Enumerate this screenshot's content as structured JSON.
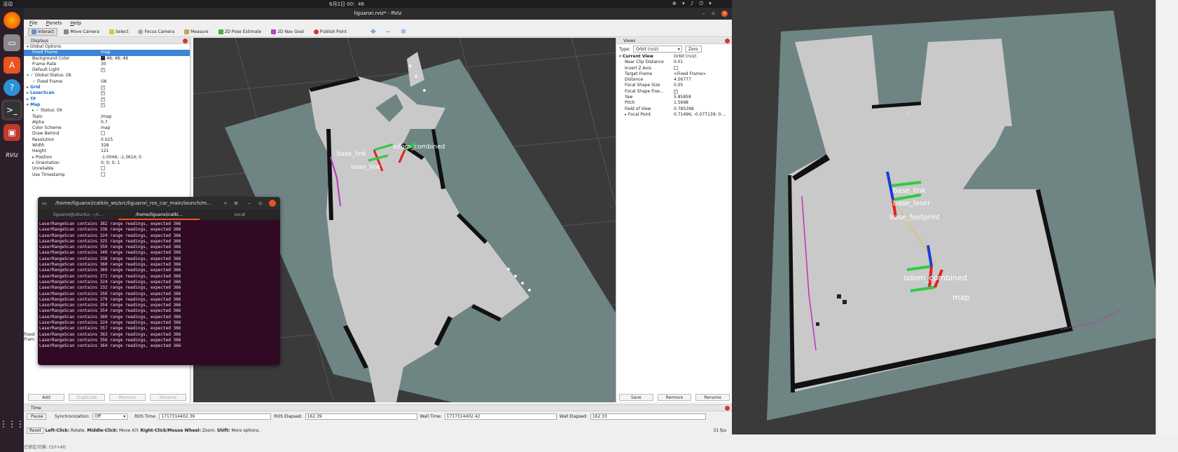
{
  "topbar": {
    "activities": "活动",
    "clock": "6月2日 00：46",
    "tray": "⊕ ▾ ♪ ⏻ ▾"
  },
  "dock": {
    "items": [
      "firefox-icon",
      "files-icon",
      "software-icon",
      "help-icon",
      "terminal-icon",
      "app-icon",
      "rviz-icon",
      "apps-grid-icon"
    ],
    "rviz_label": "RViz"
  },
  "window": {
    "title": "liguanxi.rviz* - RViz"
  },
  "menu": {
    "file": "File",
    "panels": "Panels",
    "help": "Help"
  },
  "toolbar": [
    "Interact",
    "Move Camera",
    "Select",
    "Focus Camera",
    "Measure",
    "2D Pose Estimate",
    "2D Nav Goal",
    "Publish Point"
  ],
  "displays": {
    "title": "Displays",
    "rows": [
      {
        "k": "Global Options",
        "v": "",
        "indent": 1,
        "arrow": "▾",
        "icon": "grid"
      },
      {
        "k": "Fixed Frame",
        "v": "map",
        "indent": 2,
        "hl": true
      },
      {
        "k": "Background Color",
        "v": "48; 48; 48",
        "indent": 2,
        "swatch": true
      },
      {
        "k": "Frame Rate",
        "v": "30",
        "indent": 2
      },
      {
        "k": "Default Light",
        "v": "✓",
        "indent": 2,
        "chk": true
      },
      {
        "k": "Global Status: Ok",
        "v": "",
        "indent": 1,
        "arrow": "▾",
        "check": true
      },
      {
        "k": "Fixed Frame",
        "v": "OK",
        "indent": 2,
        "check": true
      },
      {
        "k": "Grid",
        "v": "✓",
        "indent": 1,
        "arrow": "▸",
        "blue": true,
        "chk": true
      },
      {
        "k": "LaserScan",
        "v": "✓",
        "indent": 1,
        "arrow": "▸",
        "blue": true,
        "chk": true
      },
      {
        "k": "TF",
        "v": "✓",
        "indent": 1,
        "arrow": "▸",
        "blue": true,
        "chk": true
      },
      {
        "k": "Map",
        "v": "✓",
        "indent": 1,
        "arrow": "▾",
        "blue": true,
        "chk": true
      },
      {
        "k": "Status: Ok",
        "v": "",
        "indent": 2,
        "arrow": "▸",
        "check": true
      },
      {
        "k": "Topic",
        "v": "/map",
        "indent": 2
      },
      {
        "k": "Alpha",
        "v": "0.7",
        "indent": 2
      },
      {
        "k": "Color Scheme",
        "v": "map",
        "indent": 2
      },
      {
        "k": "Draw Behind",
        "v": "",
        "indent": 2,
        "chk": true
      },
      {
        "k": "Resolution",
        "v": "0.025",
        "indent": 2
      },
      {
        "k": "Width",
        "v": "328",
        "indent": 2
      },
      {
        "k": "Height",
        "v": "121",
        "indent": 2
      },
      {
        "k": "Position",
        "v": "-1.0046; -1.3614; 0",
        "indent": 2,
        "arrow": "▸"
      },
      {
        "k": "Orientation",
        "v": "0; 0; 0; 1",
        "indent": 2,
        "arrow": "▸"
      },
      {
        "k": "Unreliable",
        "v": "",
        "indent": 2,
        "chk": true
      },
      {
        "k": "Use Timestamp",
        "v": "",
        "indent": 2,
        "chk": true
      }
    ],
    "hidden_label": "Fixed\nFram",
    "buttons": {
      "add": "Add",
      "duplicate": "Duplicate",
      "remove": "Remove",
      "rename": "Rename"
    }
  },
  "views": {
    "title": "Views",
    "type_label": "Type:",
    "type_value": "Orbit (rviz)",
    "zero": "Zero",
    "rows": [
      {
        "k": "Current View",
        "v": "Orbit (rviz)",
        "indent": 1,
        "arrow": "▾",
        "bold": true
      },
      {
        "k": "Near Clip Distance",
        "v": "0.01",
        "indent": 2
      },
      {
        "k": "Invert Z Axis",
        "v": "",
        "indent": 2,
        "chk": true
      },
      {
        "k": "Target Frame",
        "v": "<Fixed Frame>",
        "indent": 2
      },
      {
        "k": "Distance",
        "v": "4.56777",
        "indent": 2
      },
      {
        "k": "Focal Shape Size",
        "v": "0.05",
        "indent": 2
      },
      {
        "k": "Focal Shape Fixe...",
        "v": "✓",
        "indent": 2,
        "chk": true
      },
      {
        "k": "Yaw",
        "v": "5.85858",
        "indent": 2
      },
      {
        "k": "Pitch",
        "v": "1.5698",
        "indent": 2
      },
      {
        "k": "Field of View",
        "v": "0.785398",
        "indent": 2
      },
      {
        "k": "Focal Point",
        "v": "0.71496; -0.077139; 0....",
        "indent": 2,
        "arrow": "▸"
      }
    ],
    "buttons": {
      "save": "Save",
      "remove": "Remove",
      "rename": "Rename"
    }
  },
  "time": {
    "title": "Time",
    "pause": "Pause",
    "sync_label": "Synchronization:",
    "sync_value": "Off",
    "ros_time_label": "ROS Time:",
    "ros_time": "1717314402.39",
    "ros_elapsed_label": "ROS Elapsed:",
    "ros_elapsed": "162.39",
    "wall_time_label": "Wall Time:",
    "wall_time": "1717314402.42",
    "wall_elapsed_label": "Wall Elapsed:",
    "wall_elapsed": "162.33"
  },
  "status": {
    "reset": "Reset",
    "left_click": "Left-Click:",
    "left_click_text": " Rotate. ",
    "middle_click": "Middle-Click:",
    "middle_click_text": " Move X/Y. ",
    "right_click": "Right-Click/Mouse Wheel:",
    "right_click_text": " Zoom. ",
    "shift": "Shift:",
    "shift_text": " More options.",
    "fps": "31 fps",
    "ime": "已锁定/切换: Ctrl+Alt"
  },
  "view3d": {
    "labels": {
      "base": "base_link",
      "odom": "odom_combined",
      "laser": "laser_link"
    }
  },
  "terminal": {
    "title": "/home/liguanxi/catkin_ws/src/liguanxi_ros_car_main/launch/m...",
    "tabs": [
      "liguanxi@ubuntu: ~/c...",
      "/home/liguanxi/catki...",
      "socat"
    ],
    "lines": [
      "LaserRangeScan contains 382 range readings, expected 366",
      "LaserRangeScan contains 336 range readings, expected 366",
      "LaserRangeScan contains 324 range readings, expected 366",
      "LaserRangeScan contains 325 range readings, expected 366",
      "LaserRangeScan contains 359 range readings, expected 366",
      "LaserRangeScan contains 349 range readings, expected 366",
      "LaserRangeScan contains 338 range readings, expected 366",
      "LaserRangeScan contains 360 range readings, expected 366",
      "LaserRangeScan contains 369 range readings, expected 366",
      "LaserRangeScan contains 372 range readings, expected 366",
      "LaserRangeScan contains 324 range readings, expected 366",
      "LaserRangeScan contains 332 range readings, expected 366",
      "LaserRangeScan contains 350 range readings, expected 366",
      "LaserRangeScan contains 379 range readings, expected 366",
      "LaserRangeScan contains 354 range readings, expected 366",
      "LaserRangeScan contains 354 range readings, expected 366",
      "LaserRangeScan contains 360 range readings, expected 366",
      "LaserRangeScan contains 324 range readings, expected 366",
      "LaserRangeScan contains 357 range readings, expected 366",
      "LaserRangeScan contains 363 range readings, expected 366",
      "LaserRangeScan contains 356 range readings, expected 366",
      "LaserRangeScan contains 364 range readings, expected 366"
    ]
  },
  "photo": {
    "labels": {
      "frame1": "base_link",
      "frame2": "base_laser",
      "frame3": "base_footprint",
      "odom": "odom_combined",
      "map": "map"
    }
  }
}
